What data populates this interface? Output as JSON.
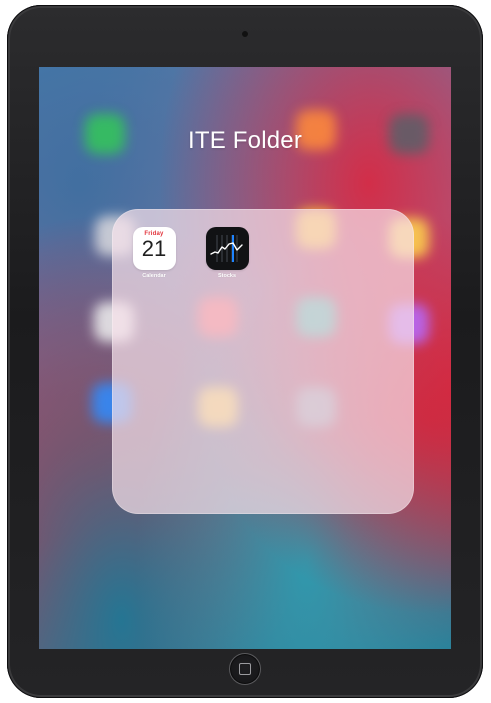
{
  "folder": {
    "title": "ITE Folder",
    "apps": [
      {
        "name": "Calendar",
        "icon": "calendar-icon",
        "day": "Friday",
        "date": "21"
      },
      {
        "name": "Stocks",
        "icon": "stocks-icon"
      }
    ]
  },
  "colors": {
    "calendar_accent": "#e2323a",
    "folder_background": "#f8e2eb",
    "stocks_background": "#111214"
  }
}
